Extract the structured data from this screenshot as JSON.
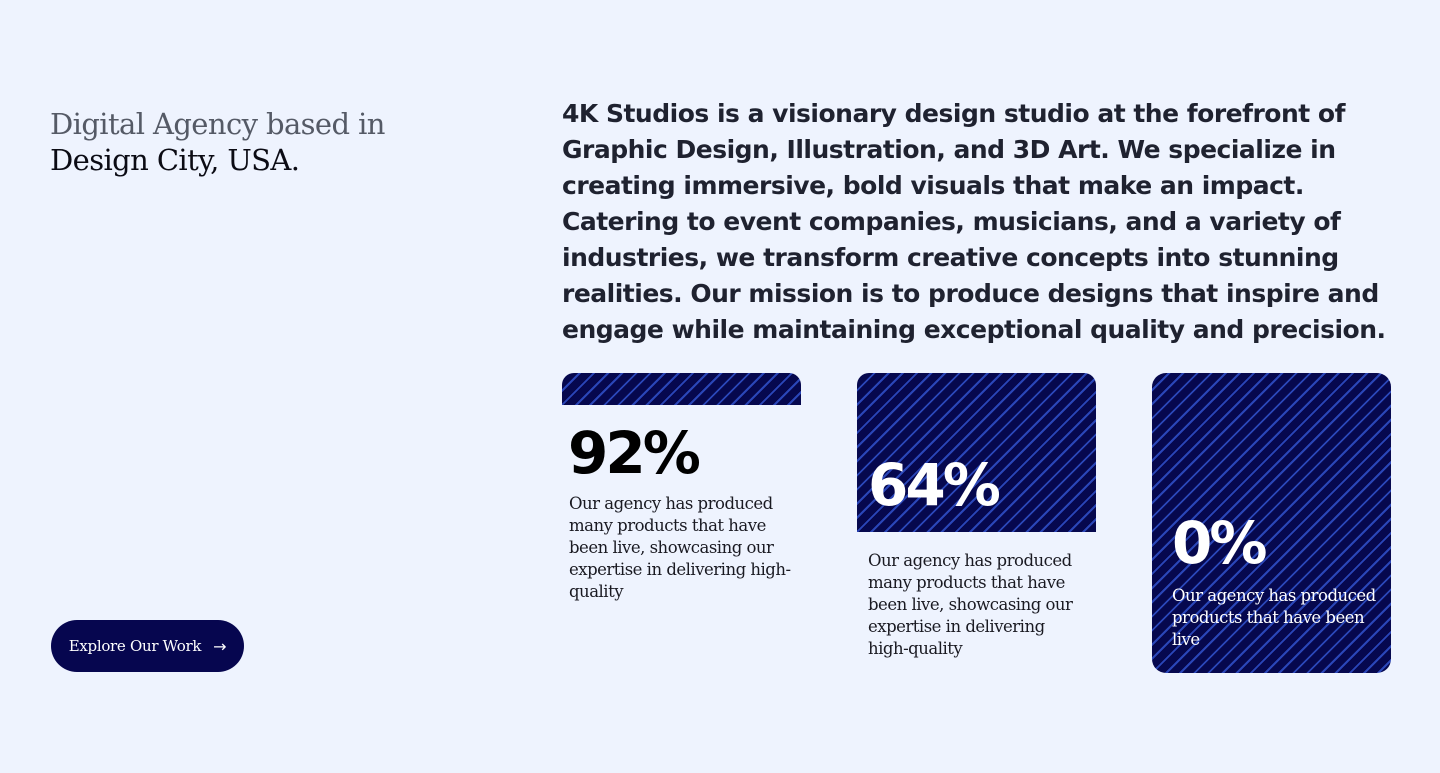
{
  "hero": {
    "tagline_line1": "Digital Agency based in",
    "tagline_line2": "Design City, USA.",
    "intro": "4K Studios is a visionary design studio at the forefront of Graphic Design, Illustration, and 3D Art. We specialize in creating immersive, bold visuals that make an impact. Catering to event companies, musicians, and a variety of industries, we transform creative concepts into stunning realities. Our mission is to produce designs that inspire and engage while maintaining exceptional quality and precision."
  },
  "cta": {
    "label": "Explore Our Work",
    "icon": "arrow-right-icon"
  },
  "stats": [
    {
      "value": "92%",
      "description": "Our agency has produced many products that have been live, showcasing our expertise in delivering high-quality"
    },
    {
      "value": "64%",
      "description": "Our agency has produced many products that have been live, showcasing our expertise in delivering high-quality"
    },
    {
      "value": "0%",
      "description": "Our agency has produced products that have been live"
    }
  ],
  "colors": {
    "background": "#eef3fe",
    "brand_navy": "#06084e",
    "stripe_blue": "#2a46b8",
    "text_dark": "#1f2230"
  }
}
